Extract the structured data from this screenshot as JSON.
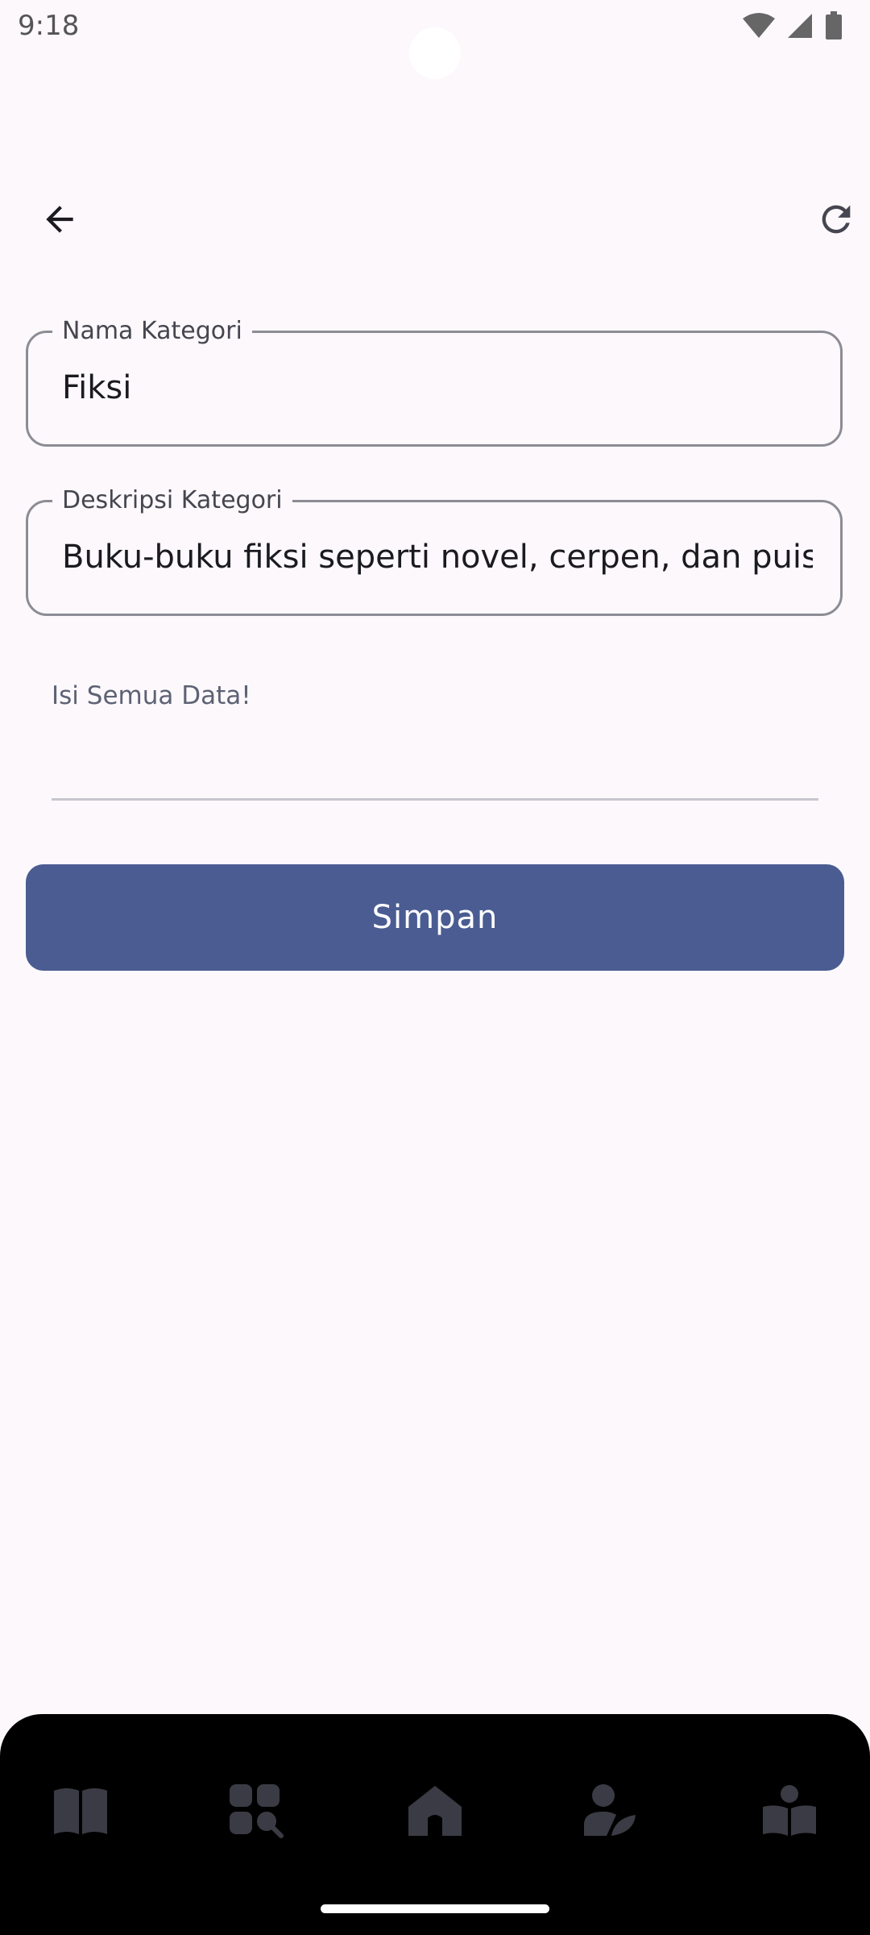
{
  "status_bar": {
    "time": "9:18"
  },
  "app_bar": {
    "back_icon": "arrow-back-icon",
    "refresh_icon": "refresh-icon"
  },
  "form": {
    "category_name": {
      "label": "Nama Kategori",
      "value": "Fiksi"
    },
    "category_description": {
      "label": "Deskripsi Kategori",
      "value": "Buku-buku fiksi seperti novel, cerpen, dan puisi."
    },
    "hint": "Isi Semua Data!",
    "save_label": "Simpan"
  },
  "bottom_nav": {
    "items": [
      {
        "icon": "book-icon"
      },
      {
        "icon": "category-search-icon"
      },
      {
        "icon": "home-icon"
      },
      {
        "icon": "person-leaf-icon"
      },
      {
        "icon": "reader-icon"
      }
    ]
  },
  "colors": {
    "primary": "#4a5c92",
    "background": "#fcf8fc",
    "nav_icon": "#3a3b44"
  }
}
